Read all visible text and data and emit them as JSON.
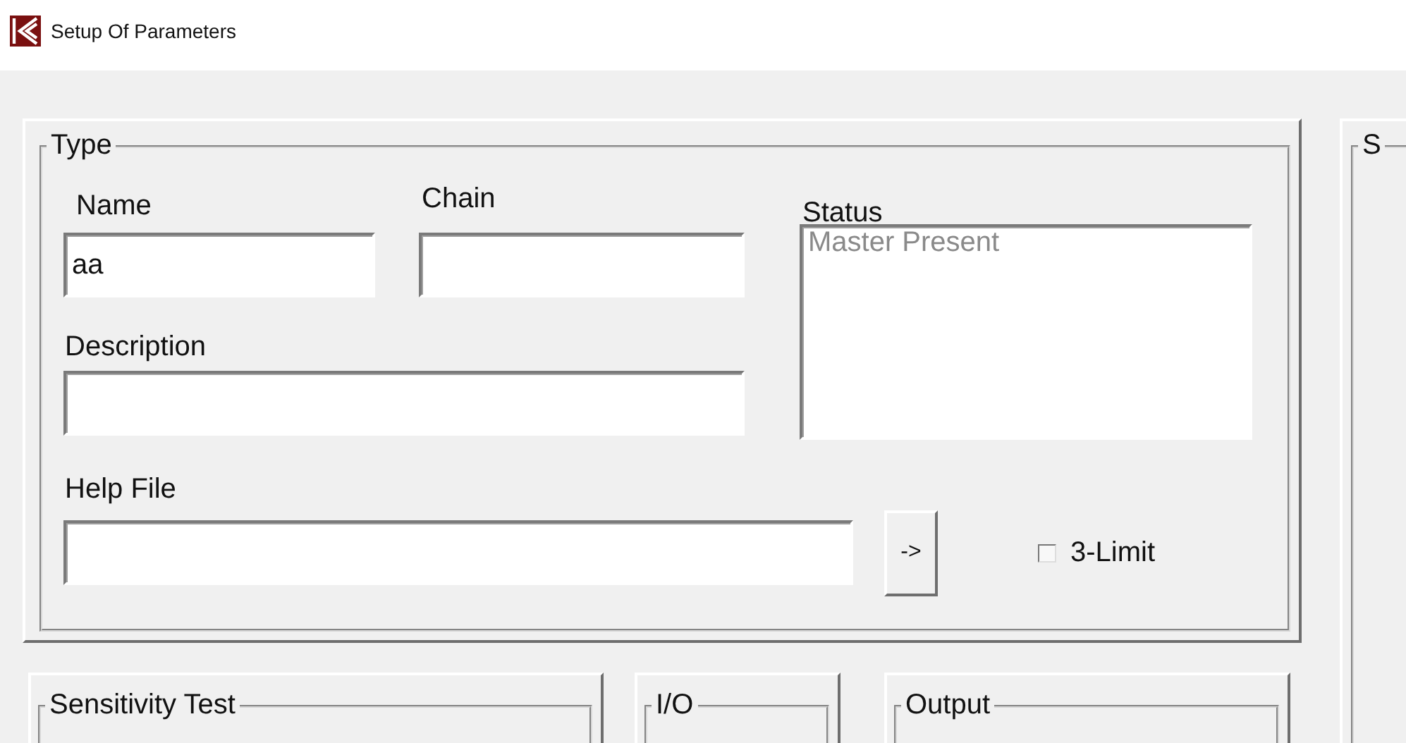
{
  "window": {
    "title": "Setup Of Parameters"
  },
  "type_group": {
    "label": "Type",
    "name": {
      "label": "Name",
      "value": "aa"
    },
    "chain": {
      "label": "Chain"
    },
    "status": {
      "label": "Status",
      "items": [
        "Master Present"
      ]
    },
    "description": {
      "label": "Description"
    },
    "help_file": {
      "label": "Help File",
      "button": "->"
    },
    "three_limit": {
      "label": "3-Limit",
      "checked": false
    }
  },
  "groups": [
    {
      "label": "Sensitivity Test"
    },
    {
      "label": "I/O"
    },
    {
      "label": "Output"
    }
  ],
  "right_group": {
    "label": "S"
  }
}
